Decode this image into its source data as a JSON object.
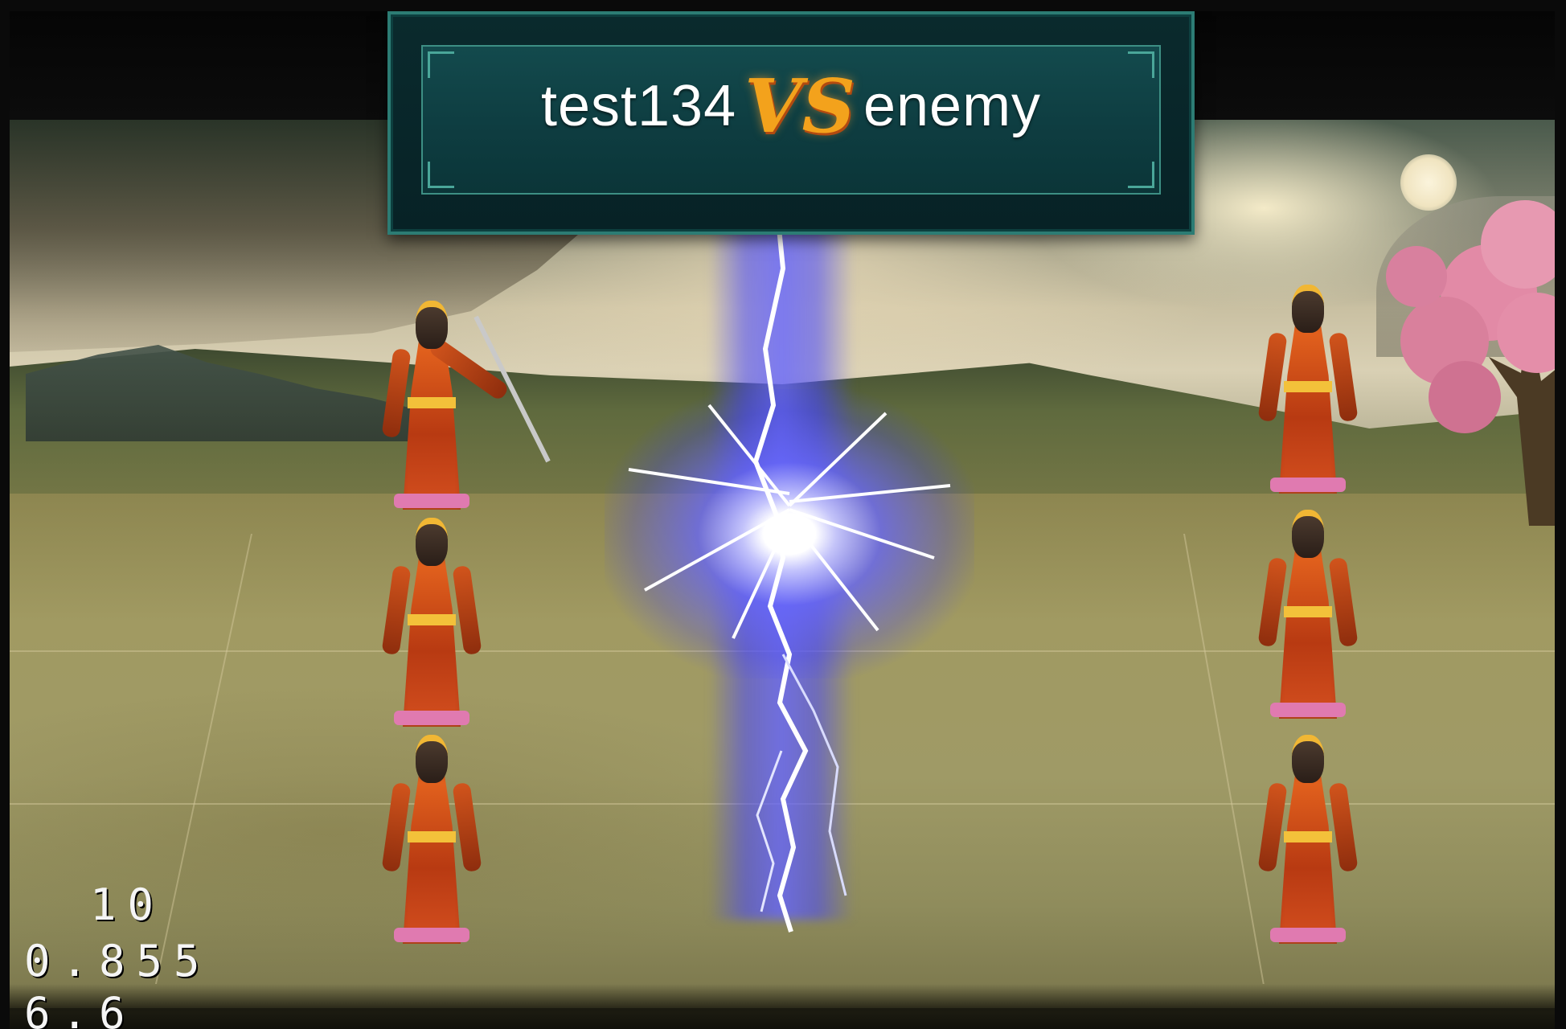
{
  "battle": {
    "player_name": "test134",
    "vs_label": "VS",
    "enemy_name": "enemy"
  },
  "effect": {
    "type": "lightning-strike",
    "color": "#4b4bff"
  },
  "fighters": {
    "player_side": [
      "warrior-attacking",
      "warrior-standing",
      "warrior-standing"
    ],
    "enemy_side": [
      "warrior-standing",
      "warrior-standing",
      "warrior-standing"
    ]
  },
  "debug_overlay": {
    "line1": "10",
    "line2": "0.855",
    "line3": "6.6"
  },
  "colors": {
    "banner_border": "#2c7c74",
    "banner_fill": "#134a4d",
    "vs_accent": "#f3a21c",
    "robe": "#d44f1f"
  }
}
